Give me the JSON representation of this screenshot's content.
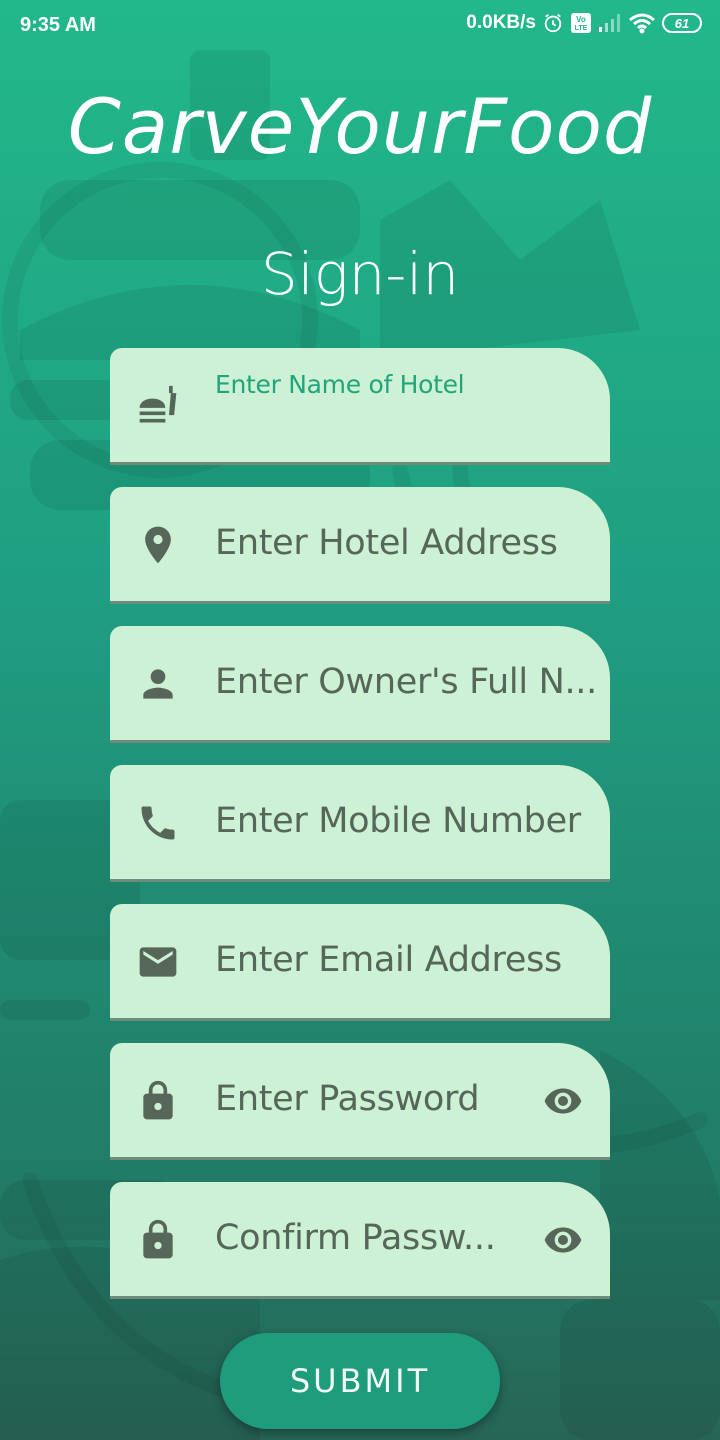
{
  "status_bar": {
    "time": "9:35 AM",
    "network_speed": "0.0KB/s",
    "volte_label": "Vo LTE",
    "battery": "61",
    "icons": [
      "alarm-icon",
      "volte-icon",
      "signal-icon",
      "wifi-icon",
      "battery-icon"
    ]
  },
  "app_title": "CarveYourFood",
  "page_title": "Sign-in",
  "fields": [
    {
      "label": "Enter Name of Hotel",
      "value": "",
      "icon": "fastfood-icon",
      "focused": true
    },
    {
      "placeholder": "Enter Hotel Address",
      "icon": "location-pin-icon"
    },
    {
      "placeholder": "Enter Owner's Full N...",
      "icon": "person-icon"
    },
    {
      "placeholder": "Enter Mobile Number",
      "icon": "phone-icon"
    },
    {
      "placeholder": "Enter Email Address",
      "icon": "email-icon"
    },
    {
      "placeholder": "Enter Password",
      "icon": "lock-icon",
      "trailing_icon": "eye-icon"
    },
    {
      "placeholder": "Confirm Passw...",
      "icon": "lock-icon",
      "trailing_icon": "eye-icon"
    }
  ],
  "submit_label": "SUBMIT",
  "colors": {
    "background_top": "#22b88a",
    "background_bottom": "#276656",
    "field_fill": "#ccf1d4",
    "field_text": "#566659",
    "focused_label": "#22a57b",
    "button": "#1e9c7c"
  }
}
